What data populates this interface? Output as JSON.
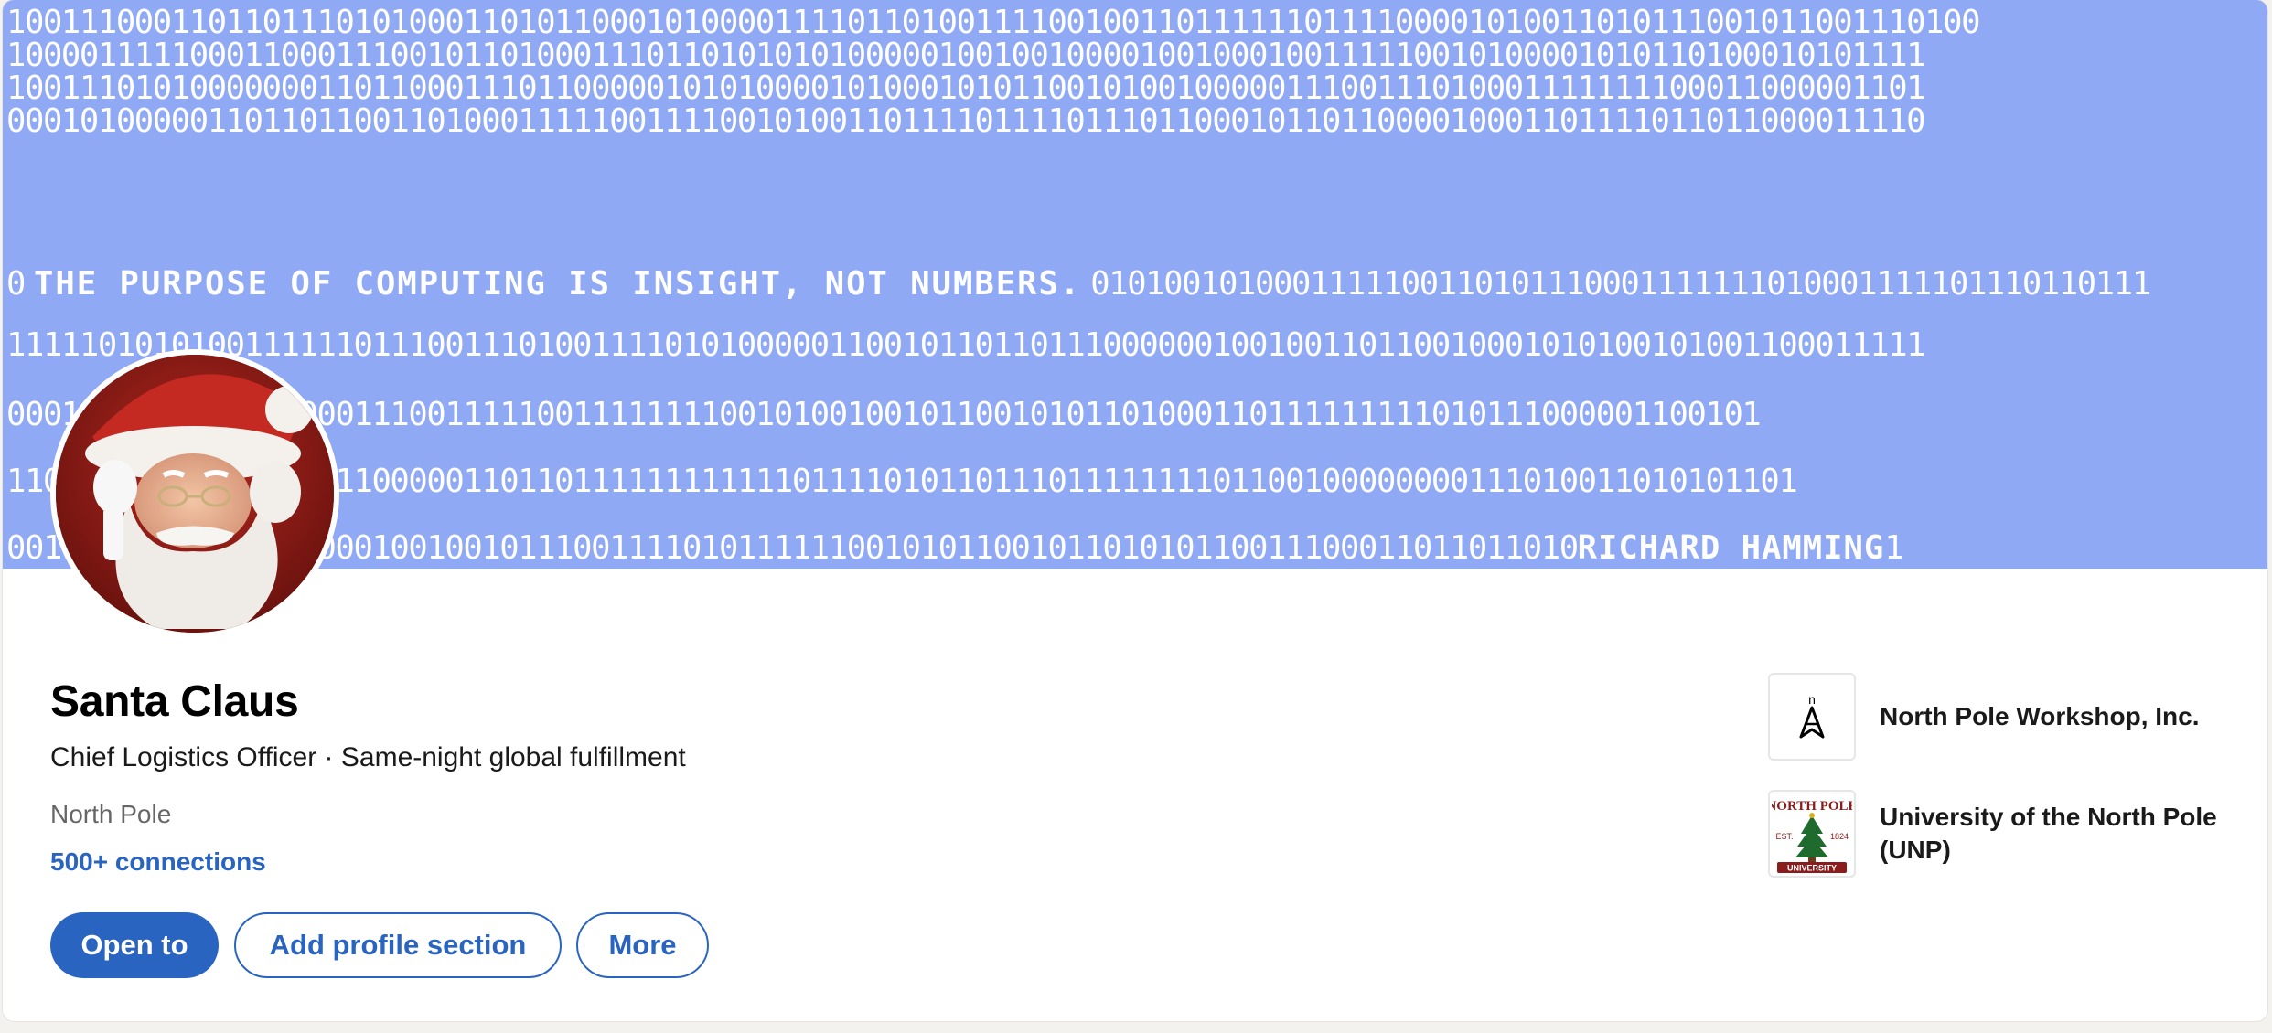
{
  "banner": {
    "rows": [
      "100111000110110111010100011010110001010000111101101001111001001101111110111100001010011010111001011001110100",
      "100001111100011000111001011010001110110101010100000100100100001001000100111110010100001010110100010101111",
      "100111010100000001101100011101100000101010000101000101011001010010000011100111010001111111100011000001101",
      "000101000001101101100110100011111001111001010011011110111101110110001011011000010001101111011011000011110",
      "0101001010001111100110101110001111111010001111101110110111",
      "111110101010011111101110011101001111010100000110010110110111000000100100110110010001010100101001100011111",
      "000101100001110000011100111110011111111001010010010110010101101000110111111111010111000001100101",
      "11000101000011010011000001101101111111111110111101011011101111111101100100000000111010011010101101",
      "00110001011010000000100100101110011110101111110010101100101101010110011100011011011010"
    ],
    "quote": "THE PURPOSE OF COMPUTING IS INSIGHT, NOT NUMBERS.",
    "quote_prefix": "0",
    "author": "RICHARD HAMMING",
    "author_suffix": "1"
  },
  "profile": {
    "name": "Santa Claus",
    "headline": "Chief Logistics Officer · Same-night global fulfillment",
    "location": "North Pole",
    "connections": "500+ connections"
  },
  "actions": {
    "open_to": "Open to",
    "add_section": "Add profile section",
    "more": "More"
  },
  "sidebar": {
    "company": "North Pole Workshop, Inc.",
    "education": "University of the North Pole (UNP)",
    "company_logo_letter": "n",
    "edu_logo": {
      "top": "NORTH POLE",
      "est": "EST.",
      "year": "1824",
      "bottom": "UNIVERSITY"
    }
  },
  "colors": {
    "banner": "#8fa9f5",
    "accent": "#2a64c1"
  }
}
